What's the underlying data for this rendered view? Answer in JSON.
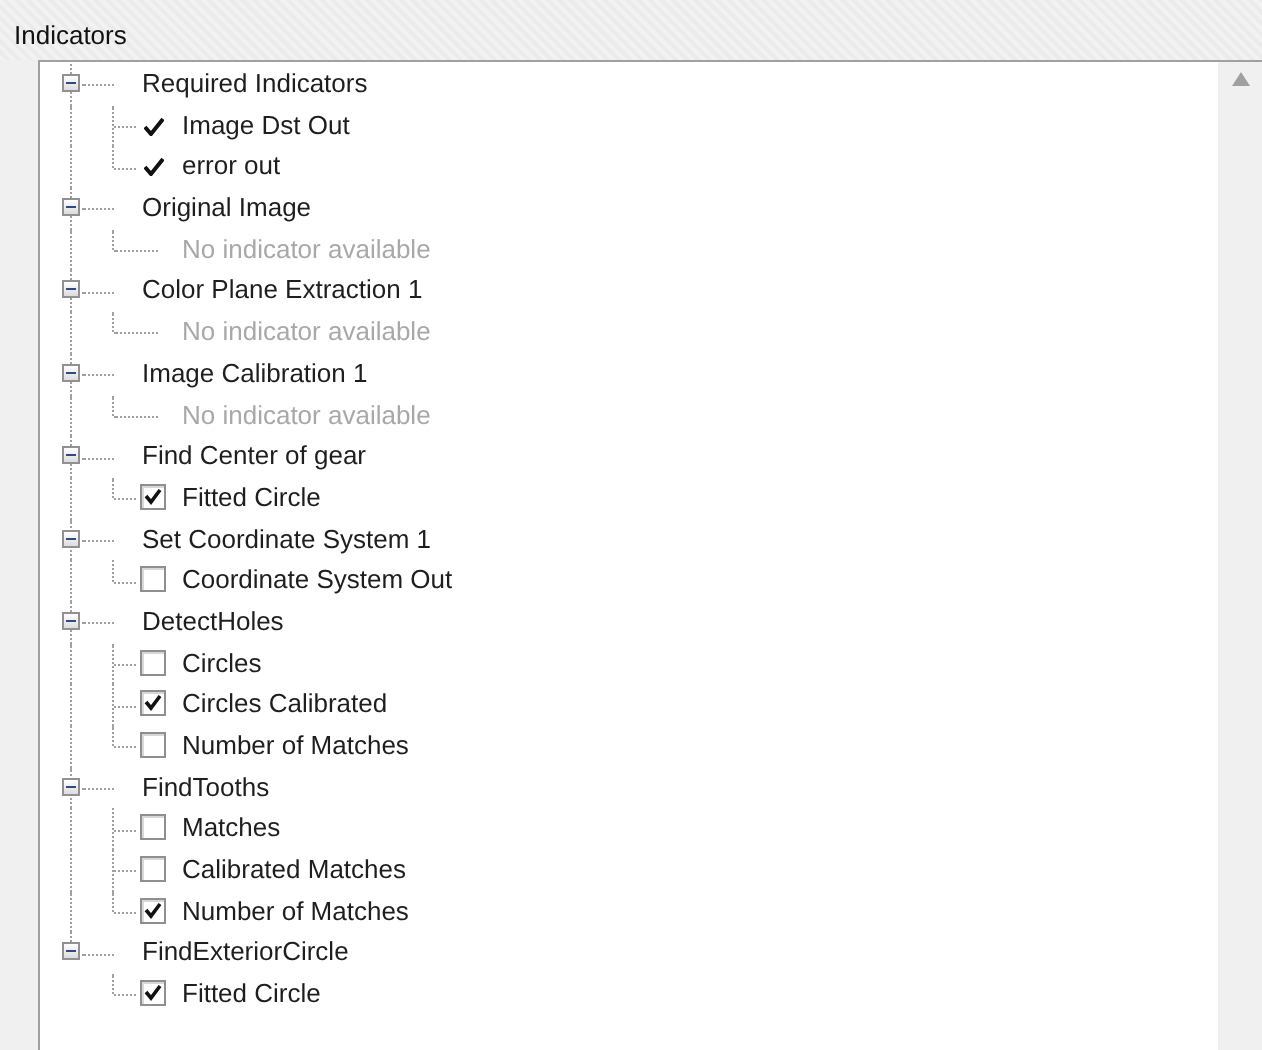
{
  "title": "Indicators",
  "groups": [
    {
      "label": "Required Indicators",
      "expanded": true,
      "children": [
        {
          "kind": "check",
          "label": "Image Dst Out",
          "checked": true
        },
        {
          "kind": "check",
          "label": "error out",
          "checked": true
        }
      ]
    },
    {
      "label": "Original Image",
      "expanded": true,
      "children": [
        {
          "kind": "none",
          "label": "No indicator available"
        }
      ]
    },
    {
      "label": "Color Plane Extraction 1",
      "expanded": true,
      "children": [
        {
          "kind": "none",
          "label": "No indicator available"
        }
      ]
    },
    {
      "label": "Image Calibration 1",
      "expanded": true,
      "children": [
        {
          "kind": "none",
          "label": "No indicator available"
        }
      ]
    },
    {
      "label": "Find Center of gear",
      "expanded": true,
      "children": [
        {
          "kind": "checkbox",
          "label": "Fitted Circle",
          "checked": true
        }
      ]
    },
    {
      "label": "Set Coordinate System 1",
      "expanded": true,
      "children": [
        {
          "kind": "checkbox",
          "label": "Coordinate System Out",
          "checked": false
        }
      ]
    },
    {
      "label": "DetectHoles",
      "expanded": true,
      "children": [
        {
          "kind": "checkbox",
          "label": "Circles",
          "checked": false
        },
        {
          "kind": "checkbox",
          "label": "Circles Calibrated",
          "checked": true
        },
        {
          "kind": "checkbox",
          "label": "Number of Matches",
          "checked": false
        }
      ]
    },
    {
      "label": "FindTooths",
      "expanded": true,
      "children": [
        {
          "kind": "checkbox",
          "label": "Matches",
          "checked": false
        },
        {
          "kind": "checkbox",
          "label": "Calibrated Matches",
          "checked": false
        },
        {
          "kind": "checkbox",
          "label": "Number of Matches",
          "checked": true
        }
      ]
    },
    {
      "label": "FindExteriorCircle",
      "expanded": true,
      "children": [
        {
          "kind": "checkbox",
          "label": "Fitted Circle",
          "checked": true
        }
      ]
    }
  ]
}
